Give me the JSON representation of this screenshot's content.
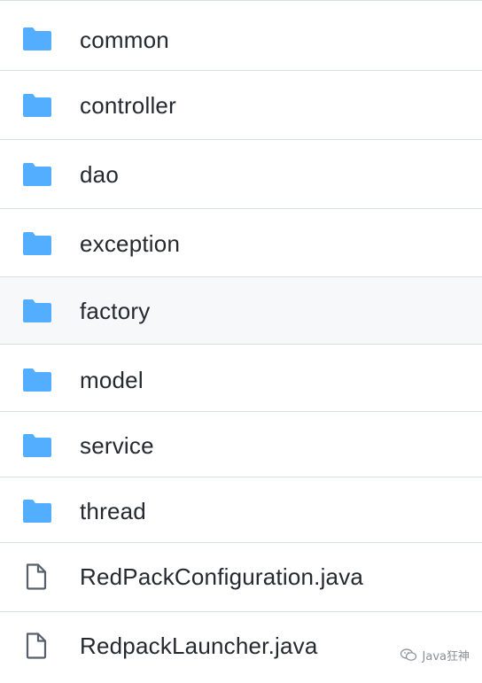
{
  "files": [
    {
      "name": "common",
      "type": "directory",
      "icon": "folder-icon"
    },
    {
      "name": "controller",
      "type": "directory",
      "icon": "folder-icon"
    },
    {
      "name": "dao",
      "type": "directory",
      "icon": "folder-icon"
    },
    {
      "name": "exception",
      "type": "directory",
      "icon": "folder-icon"
    },
    {
      "name": "factory",
      "type": "directory",
      "icon": "folder-icon",
      "hovered": true
    },
    {
      "name": "model",
      "type": "directory",
      "icon": "folder-icon"
    },
    {
      "name": "service",
      "type": "directory",
      "icon": "folder-icon"
    },
    {
      "name": "thread",
      "type": "directory",
      "icon": "folder-icon"
    },
    {
      "name": "RedPackConfiguration.java",
      "type": "file",
      "icon": "file-icon"
    },
    {
      "name": "RedpackLauncher.java",
      "type": "file",
      "icon": "file-icon"
    }
  ],
  "watermark": {
    "text": "Java狂神",
    "icon": "wechat-icon"
  },
  "colors": {
    "folder": "#54aeff",
    "file_icon": "#57606a",
    "text": "#24292f",
    "border": "#d8dee4",
    "hover_bg": "#f6f8fa"
  }
}
